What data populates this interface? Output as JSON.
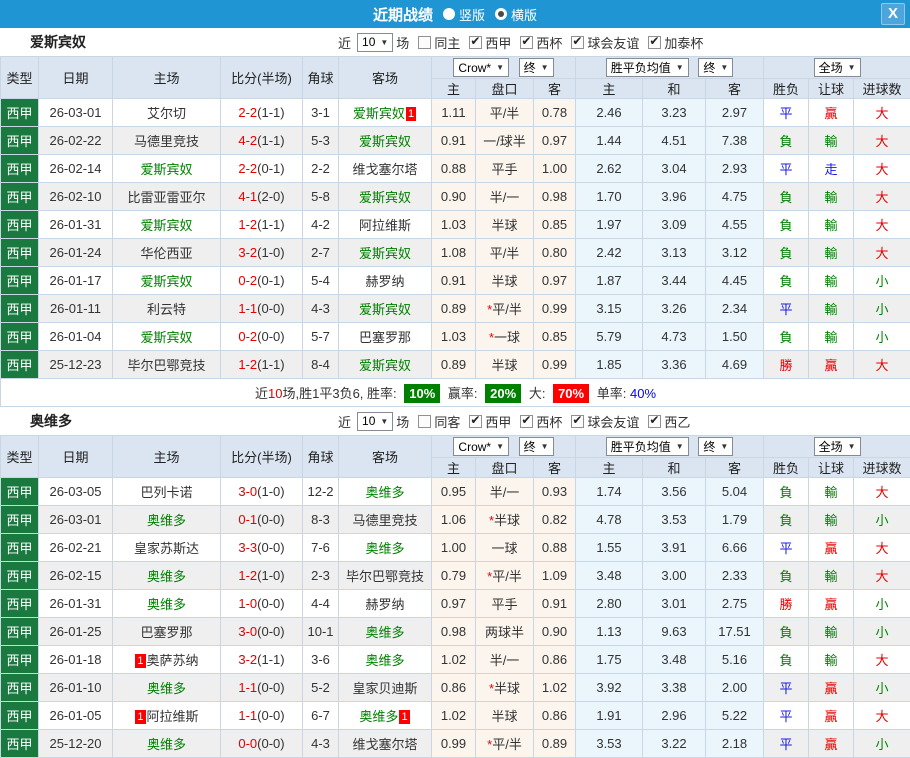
{
  "titlebar": {
    "title": "近期战绩",
    "radios": [
      {
        "label": "竖版",
        "checked": false
      },
      {
        "label": "横版",
        "checked": true
      }
    ],
    "close": "X"
  },
  "colors": {
    "titlebar_blue": "#2095d3",
    "header_bg": "#dbe5f1",
    "league_green": "#19793f",
    "team_green": "#008000",
    "score_red": "#e60000",
    "result_red": "#e60000",
    "result_blue": "#1a1ae6",
    "result_green": "#008000",
    "odds_bg": "#fbf5ee",
    "mean_bg": "#eaf5fc",
    "alt_row_bg": "#efefef",
    "badge_red": "#ff0000",
    "badge_green": "#008000"
  },
  "table": {
    "headers": {
      "type": "类型",
      "date": "日期",
      "home": "主场",
      "score": "比分(半场)",
      "corner": "角球",
      "away": "客场",
      "odds_home": "主",
      "odds_line": "盘口",
      "odds_away": "客",
      "mean_home": "主",
      "mean_draw": "和",
      "mean_away": "客",
      "wdl": "胜负",
      "handicap": "让球",
      "goals": "进球数"
    },
    "selects": {
      "crow": "Crow*",
      "final1": "终",
      "mean": "胜平负均值",
      "final2": "终",
      "scope": "全场"
    }
  },
  "sections": [
    {
      "team": "爱斯宾奴",
      "filter": {
        "prefix": "近",
        "count": "10",
        "suffix": "场",
        "same_label": "同主",
        "same_checked": false,
        "leagues": [
          {
            "label": "西甲",
            "checked": true
          },
          {
            "label": "西杯",
            "checked": true
          },
          {
            "label": "球会友谊",
            "checked": true
          },
          {
            "label": "加泰杯",
            "checked": true
          }
        ]
      },
      "rows": [
        {
          "league": "西甲",
          "date": "26-03-01",
          "home": "艾尔切",
          "home_green": false,
          "home_badge_before": "",
          "home_badge_after": "",
          "score_ft": "2-2",
          "score_ht": "(1-1)",
          "corner": "3-1",
          "away": "爱斯宾奴",
          "away_green": true,
          "away_badge_before": "",
          "away_badge_after": "1",
          "odds_home": "1.11",
          "line_star": false,
          "line": "平/半",
          "odds_away": "0.78",
          "mean_home": "2.46",
          "mean_draw": "3.23",
          "mean_away": "2.97",
          "wdl": "平",
          "handicap": "贏",
          "goals": "大"
        },
        {
          "league": "西甲",
          "date": "26-02-22",
          "home": "马德里竞技",
          "home_green": false,
          "home_badge_before": "",
          "home_badge_after": "",
          "score_ft": "4-2",
          "score_ht": "(1-1)",
          "corner": "5-3",
          "away": "爱斯宾奴",
          "away_green": true,
          "away_badge_before": "",
          "away_badge_after": "",
          "odds_home": "0.91",
          "line_star": false,
          "line": "一/球半",
          "odds_away": "0.97",
          "mean_home": "1.44",
          "mean_draw": "4.51",
          "mean_away": "7.38",
          "wdl": "負",
          "handicap": "輸",
          "goals": "大"
        },
        {
          "league": "西甲",
          "date": "26-02-14",
          "home": "爱斯宾奴",
          "home_green": true,
          "home_badge_before": "",
          "home_badge_after": "",
          "score_ft": "2-2",
          "score_ht": "(0-1)",
          "corner": "2-2",
          "away": "维戈塞尔塔",
          "away_green": false,
          "away_badge_before": "",
          "away_badge_after": "",
          "odds_home": "0.88",
          "line_star": false,
          "line": "平手",
          "odds_away": "1.00",
          "mean_home": "2.62",
          "mean_draw": "3.04",
          "mean_away": "2.93",
          "wdl": "平",
          "handicap": "走",
          "goals": "大"
        },
        {
          "league": "西甲",
          "date": "26-02-10",
          "home": "比雷亚雷亚尔",
          "home_green": false,
          "home_badge_before": "",
          "home_badge_after": "",
          "score_ft": "4-1",
          "score_ht": "(2-0)",
          "corner": "5-8",
          "away": "爱斯宾奴",
          "away_green": true,
          "away_badge_before": "",
          "away_badge_after": "",
          "odds_home": "0.90",
          "line_star": false,
          "line": "半/一",
          "odds_away": "0.98",
          "mean_home": "1.70",
          "mean_draw": "3.96",
          "mean_away": "4.75",
          "wdl": "負",
          "handicap": "輸",
          "goals": "大"
        },
        {
          "league": "西甲",
          "date": "26-01-31",
          "home": "爱斯宾奴",
          "home_green": true,
          "home_badge_before": "",
          "home_badge_after": "",
          "score_ft": "1-2",
          "score_ht": "(1-1)",
          "corner": "4-2",
          "away": "阿拉维斯",
          "away_green": false,
          "away_badge_before": "",
          "away_badge_after": "",
          "odds_home": "1.03",
          "line_star": false,
          "line": "半球",
          "odds_away": "0.85",
          "mean_home": "1.97",
          "mean_draw": "3.09",
          "mean_away": "4.55",
          "wdl": "負",
          "handicap": "輸",
          "goals": "大"
        },
        {
          "league": "西甲",
          "date": "26-01-24",
          "home": "华伦西亚",
          "home_green": false,
          "home_badge_before": "",
          "home_badge_after": "",
          "score_ft": "3-2",
          "score_ht": "(1-0)",
          "corner": "2-7",
          "away": "爱斯宾奴",
          "away_green": true,
          "away_badge_before": "",
          "away_badge_after": "",
          "odds_home": "1.08",
          "line_star": false,
          "line": "平/半",
          "odds_away": "0.80",
          "mean_home": "2.42",
          "mean_draw": "3.13",
          "mean_away": "3.12",
          "wdl": "負",
          "handicap": "輸",
          "goals": "大"
        },
        {
          "league": "西甲",
          "date": "26-01-17",
          "home": "爱斯宾奴",
          "home_green": true,
          "home_badge_before": "",
          "home_badge_after": "",
          "score_ft": "0-2",
          "score_ht": "(0-1)",
          "corner": "5-4",
          "away": "赫罗纳",
          "away_green": false,
          "away_badge_before": "",
          "away_badge_after": "",
          "odds_home": "0.91",
          "line_star": false,
          "line": "半球",
          "odds_away": "0.97",
          "mean_home": "1.87",
          "mean_draw": "3.44",
          "mean_away": "4.45",
          "wdl": "負",
          "handicap": "輸",
          "goals": "小"
        },
        {
          "league": "西甲",
          "date": "26-01-11",
          "home": "利云特",
          "home_green": false,
          "home_badge_before": "",
          "home_badge_after": "",
          "score_ft": "1-1",
          "score_ht": "(0-0)",
          "corner": "4-3",
          "away": "爱斯宾奴",
          "away_green": true,
          "away_badge_before": "",
          "away_badge_after": "",
          "odds_home": "0.89",
          "line_star": true,
          "line": "平/半",
          "odds_away": "0.99",
          "mean_home": "3.15",
          "mean_draw": "3.26",
          "mean_away": "2.34",
          "wdl": "平",
          "handicap": "輸",
          "goals": "小"
        },
        {
          "league": "西甲",
          "date": "26-01-04",
          "home": "爱斯宾奴",
          "home_green": true,
          "home_badge_before": "",
          "home_badge_after": "",
          "score_ft": "0-2",
          "score_ht": "(0-0)",
          "corner": "5-7",
          "away": "巴塞罗那",
          "away_green": false,
          "away_badge_before": "",
          "away_badge_after": "",
          "odds_home": "1.03",
          "line_star": true,
          "line": "一球",
          "odds_away": "0.85",
          "mean_home": "5.79",
          "mean_draw": "4.73",
          "mean_away": "1.50",
          "wdl": "負",
          "handicap": "輸",
          "goals": "小"
        },
        {
          "league": "西甲",
          "date": "25-12-23",
          "home": "毕尔巴鄂竞技",
          "home_green": false,
          "home_badge_before": "",
          "home_badge_after": "",
          "score_ft": "1-2",
          "score_ht": "(1-1)",
          "corner": "8-4",
          "away": "爱斯宾奴",
          "away_green": true,
          "away_badge_before": "",
          "away_badge_after": "",
          "odds_home": "0.89",
          "line_star": false,
          "line": "半球",
          "odds_away": "0.99",
          "mean_home": "1.85",
          "mean_draw": "3.36",
          "mean_away": "4.69",
          "wdl": "勝",
          "handicap": "贏",
          "goals": "大"
        }
      ],
      "summary": {
        "lead": "近",
        "count": "10",
        "mid": "场,胜1平3负6, 胜率:",
        "win_rate": "10%",
        "label_asian": "赢率:",
        "asian_rate": "20%",
        "label_big": "大:",
        "big_rate": "70%",
        "label_single": "单率:",
        "single_rate": "40%"
      }
    },
    {
      "team": "奥维多",
      "filter": {
        "prefix": "近",
        "count": "10",
        "suffix": "场",
        "same_label": "同客",
        "same_checked": false,
        "leagues": [
          {
            "label": "西甲",
            "checked": true
          },
          {
            "label": "西杯",
            "checked": true
          },
          {
            "label": "球会友谊",
            "checked": true
          },
          {
            "label": "西乙",
            "checked": true
          }
        ]
      },
      "rows": [
        {
          "league": "西甲",
          "date": "26-03-05",
          "home": "巴列卡诺",
          "home_green": false,
          "home_badge_before": "",
          "home_badge_after": "",
          "score_ft": "3-0",
          "score_ht": "(1-0)",
          "corner": "12-2",
          "away": "奥维多",
          "away_green": true,
          "away_badge_before": "",
          "away_badge_after": "",
          "odds_home": "0.95",
          "line_star": false,
          "line": "半/一",
          "odds_away": "0.93",
          "mean_home": "1.74",
          "mean_draw": "3.56",
          "mean_away": "5.04",
          "wdl": "負",
          "handicap": "輸",
          "goals": "大"
        },
        {
          "league": "西甲",
          "date": "26-03-01",
          "home": "奥维多",
          "home_green": true,
          "home_badge_before": "",
          "home_badge_after": "",
          "score_ft": "0-1",
          "score_ht": "(0-0)",
          "corner": "8-3",
          "away": "马德里竞技",
          "away_green": false,
          "away_badge_before": "",
          "away_badge_after": "",
          "odds_home": "1.06",
          "line_star": true,
          "line": "半球",
          "odds_away": "0.82",
          "mean_home": "4.78",
          "mean_draw": "3.53",
          "mean_away": "1.79",
          "wdl": "負",
          "handicap": "輸",
          "goals": "小"
        },
        {
          "league": "西甲",
          "date": "26-02-21",
          "home": "皇家苏斯达",
          "home_green": false,
          "home_badge_before": "",
          "home_badge_after": "",
          "score_ft": "3-3",
          "score_ht": "(0-0)",
          "corner": "7-6",
          "away": "奥维多",
          "away_green": true,
          "away_badge_before": "",
          "away_badge_after": "",
          "odds_home": "1.00",
          "line_star": false,
          "line": "一球",
          "odds_away": "0.88",
          "mean_home": "1.55",
          "mean_draw": "3.91",
          "mean_away": "6.66",
          "wdl": "平",
          "handicap": "贏",
          "goals": "大"
        },
        {
          "league": "西甲",
          "date": "26-02-15",
          "home": "奥维多",
          "home_green": true,
          "home_badge_before": "",
          "home_badge_after": "",
          "score_ft": "1-2",
          "score_ht": "(1-0)",
          "corner": "2-3",
          "away": "毕尔巴鄂竞技",
          "away_green": false,
          "away_badge_before": "",
          "away_badge_after": "",
          "odds_home": "0.79",
          "line_star": true,
          "line": "平/半",
          "odds_away": "1.09",
          "mean_home": "3.48",
          "mean_draw": "3.00",
          "mean_away": "2.33",
          "wdl": "負",
          "handicap": "輸",
          "goals": "大"
        },
        {
          "league": "西甲",
          "date": "26-01-31",
          "home": "奥维多",
          "home_green": true,
          "home_badge_before": "",
          "home_badge_after": "",
          "score_ft": "1-0",
          "score_ht": "(0-0)",
          "corner": "4-4",
          "away": "赫罗纳",
          "away_green": false,
          "away_badge_before": "",
          "away_badge_after": "",
          "odds_home": "0.97",
          "line_star": false,
          "line": "平手",
          "odds_away": "0.91",
          "mean_home": "2.80",
          "mean_draw": "3.01",
          "mean_away": "2.75",
          "wdl": "勝",
          "handicap": "贏",
          "goals": "小"
        },
        {
          "league": "西甲",
          "date": "26-01-25",
          "home": "巴塞罗那",
          "home_green": false,
          "home_badge_before": "",
          "home_badge_after": "",
          "score_ft": "3-0",
          "score_ht": "(0-0)",
          "corner": "10-1",
          "away": "奥维多",
          "away_green": true,
          "away_badge_before": "",
          "away_badge_after": "",
          "odds_home": "0.98",
          "line_star": false,
          "line": "两球半",
          "odds_away": "0.90",
          "mean_home": "1.13",
          "mean_draw": "9.63",
          "mean_away": "17.51",
          "wdl": "負",
          "handicap": "輸",
          "goals": "小"
        },
        {
          "league": "西甲",
          "date": "26-01-18",
          "home": "奥萨苏纳",
          "home_green": false,
          "home_badge_before": "1",
          "home_badge_after": "",
          "score_ft": "3-2",
          "score_ht": "(1-1)",
          "corner": "3-6",
          "away": "奥维多",
          "away_green": true,
          "away_badge_before": "",
          "away_badge_after": "",
          "odds_home": "1.02",
          "line_star": false,
          "line": "半/一",
          "odds_away": "0.86",
          "mean_home": "1.75",
          "mean_draw": "3.48",
          "mean_away": "5.16",
          "wdl": "負",
          "handicap": "輸",
          "goals": "大"
        },
        {
          "league": "西甲",
          "date": "26-01-10",
          "home": "奥维多",
          "home_green": true,
          "home_badge_before": "",
          "home_badge_after": "",
          "score_ft": "1-1",
          "score_ht": "(0-0)",
          "corner": "5-2",
          "away": "皇家贝迪斯",
          "away_green": false,
          "away_badge_before": "",
          "away_badge_after": "",
          "odds_home": "0.86",
          "line_star": true,
          "line": "半球",
          "odds_away": "1.02",
          "mean_home": "3.92",
          "mean_draw": "3.38",
          "mean_away": "2.00",
          "wdl": "平",
          "handicap": "贏",
          "goals": "小"
        },
        {
          "league": "西甲",
          "date": "26-01-05",
          "home": "阿拉维斯",
          "home_green": false,
          "home_badge_before": "1",
          "home_badge_after": "",
          "score_ft": "1-1",
          "score_ht": "(0-0)",
          "corner": "6-7",
          "away": "奥维多",
          "away_green": true,
          "away_badge_before": "",
          "away_badge_after": "1",
          "odds_home": "1.02",
          "line_star": false,
          "line": "半球",
          "odds_away": "0.86",
          "mean_home": "1.91",
          "mean_draw": "2.96",
          "mean_away": "5.22",
          "wdl": "平",
          "handicap": "贏",
          "goals": "大"
        },
        {
          "league": "西甲",
          "date": "25-12-20",
          "home": "奥维多",
          "home_green": true,
          "home_badge_before": "",
          "home_badge_after": "",
          "score_ft": "0-0",
          "score_ht": "(0-0)",
          "corner": "4-3",
          "away": "维戈塞尔塔",
          "away_green": false,
          "away_badge_before": "",
          "away_badge_after": "",
          "odds_home": "0.99",
          "line_star": true,
          "line": "平/半",
          "odds_away": "0.89",
          "mean_home": "3.53",
          "mean_draw": "3.22",
          "mean_away": "2.18",
          "wdl": "平",
          "handicap": "贏",
          "goals": "小"
        }
      ]
    }
  ]
}
